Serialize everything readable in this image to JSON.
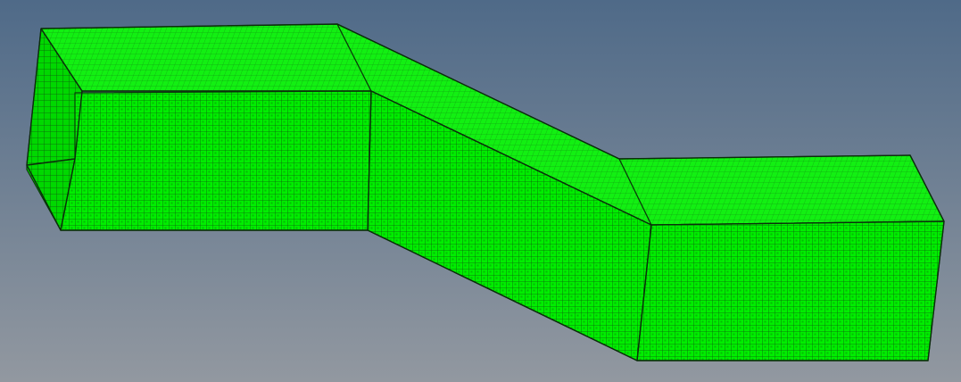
{
  "viewport": {
    "background_top_color": "#4f6a88",
    "background_bottom_color": "#9298a0"
  },
  "model": {
    "mesh_color": "#00ee00",
    "mesh_top_color": "#12f012",
    "mesh_shade_color": "#00d800",
    "mesh_line_color": "#0f5a0f",
    "edge_color": "#0b2e0b"
  }
}
